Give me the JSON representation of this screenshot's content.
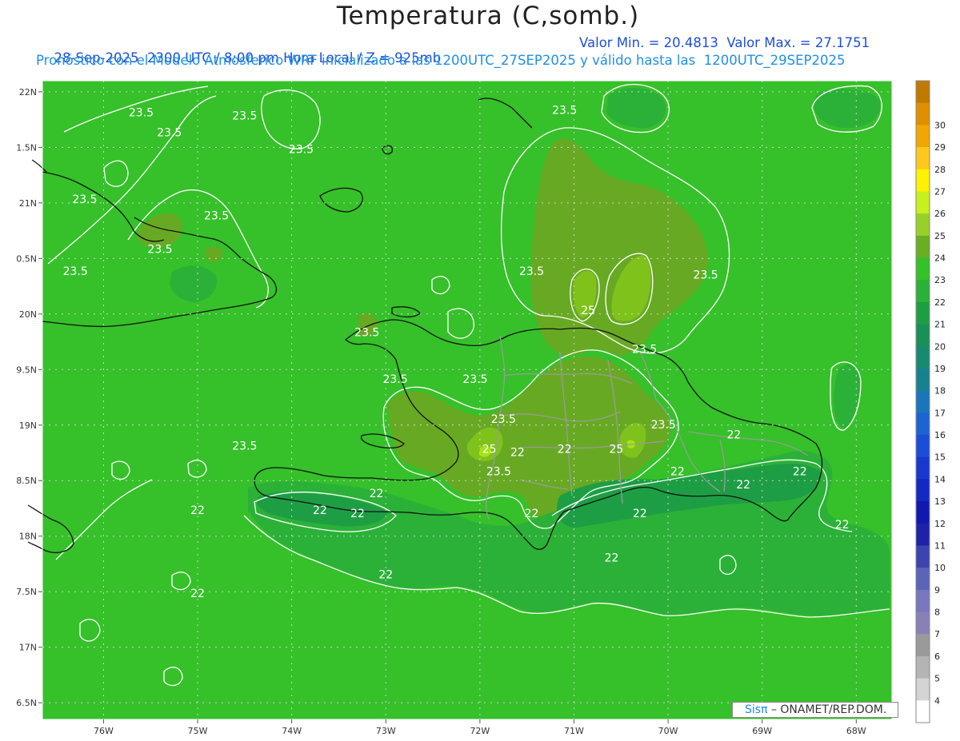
{
  "header": {
    "title": "Temperatura (C,somb.)",
    "line1_left": "28-Sep-2025  2300 UTC / 8:00 pm Hora Local / Z = 925mb",
    "line1_right": "Valor Min. = 20.4813  Valor Max. = 27.1751",
    "line2": "Pronóstico con el Modelo Atmosferico WRF inicializado a las 1200UTC_27SEP2025 y válido hasta las  1200UTC_29SEP2025"
  },
  "map": {
    "lon_range": [
      -76.65,
      -67.62
    ],
    "lat_range": [
      16.35,
      22.1
    ],
    "lat_ticks": [
      {
        "value": 22,
        "label": "22N"
      },
      {
        "value": 21.5,
        "label": "1.5N"
      },
      {
        "value": 21,
        "label": "21N"
      },
      {
        "value": 20.5,
        "label": "0.5N"
      },
      {
        "value": 20,
        "label": "20N"
      },
      {
        "value": 19.5,
        "label": "9.5N"
      },
      {
        "value": 19,
        "label": "19N"
      },
      {
        "value": 18.5,
        "label": "8.5N"
      },
      {
        "value": 18,
        "label": "18N"
      },
      {
        "value": 17.5,
        "label": "7.5N"
      },
      {
        "value": 17,
        "label": "17N"
      },
      {
        "value": 16.5,
        "label": "6.5N"
      }
    ],
    "lon_ticks": [
      {
        "value": -76,
        "label": "76W"
      },
      {
        "value": -75,
        "label": "75W"
      },
      {
        "value": -74,
        "label": "74W"
      },
      {
        "value": -73,
        "label": "73W"
      },
      {
        "value": -72,
        "label": "72W"
      },
      {
        "value": -71,
        "label": "71W"
      },
      {
        "value": -70,
        "label": "70W"
      },
      {
        "value": -69,
        "label": "69W"
      },
      {
        "value": -68,
        "label": "68W"
      }
    ],
    "contour_labels": [
      {
        "text": "23.5",
        "lon": -75.6,
        "lat": 21.78
      },
      {
        "text": "23.5",
        "lon": -74.5,
        "lat": 21.75
      },
      {
        "text": "23.5",
        "lon": -75.3,
        "lat": 21.6
      },
      {
        "text": "23.5",
        "lon": -73.9,
        "lat": 21.45
      },
      {
        "text": "23.5",
        "lon": -76.2,
        "lat": 21.0
      },
      {
        "text": "23.5",
        "lon": -74.8,
        "lat": 20.85
      },
      {
        "text": "23.5",
        "lon": -75.4,
        "lat": 20.55
      },
      {
        "text": "23.5",
        "lon": -76.3,
        "lat": 20.35
      },
      {
        "text": "23.5",
        "lon": -71.1,
        "lat": 21.8
      },
      {
        "text": "23.5",
        "lon": -71.45,
        "lat": 20.35
      },
      {
        "text": "23.5",
        "lon": -69.6,
        "lat": 20.32
      },
      {
        "text": "25",
        "lon": -70.85,
        "lat": 20.0
      },
      {
        "text": "23.5",
        "lon": -73.2,
        "lat": 19.8
      },
      {
        "text": "23.5",
        "lon": -70.25,
        "lat": 19.65
      },
      {
        "text": "23.5",
        "lon": -72.9,
        "lat": 19.38
      },
      {
        "text": "23.5",
        "lon": -72.05,
        "lat": 19.38
      },
      {
        "text": "23.5",
        "lon": -71.75,
        "lat": 19.02
      },
      {
        "text": "23.5",
        "lon": -70.05,
        "lat": 18.97
      },
      {
        "text": "23.5",
        "lon": -74.5,
        "lat": 18.78
      },
      {
        "text": "25",
        "lon": -71.9,
        "lat": 18.75
      },
      {
        "text": "22",
        "lon": -71.6,
        "lat": 18.72
      },
      {
        "text": "22",
        "lon": -71.1,
        "lat": 18.75
      },
      {
        "text": "25",
        "lon": -70.55,
        "lat": 18.75
      },
      {
        "text": "22",
        "lon": -69.3,
        "lat": 18.88
      },
      {
        "text": "23.5",
        "lon": -71.8,
        "lat": 18.55
      },
      {
        "text": "22",
        "lon": -69.9,
        "lat": 18.55
      },
      {
        "text": "22",
        "lon": -69.2,
        "lat": 18.43
      },
      {
        "text": "22",
        "lon": -68.6,
        "lat": 18.55
      },
      {
        "text": "22",
        "lon": -73.1,
        "lat": 18.35
      },
      {
        "text": "22",
        "lon": -75.0,
        "lat": 18.2
      },
      {
        "text": "22",
        "lon": -73.7,
        "lat": 18.2
      },
      {
        "text": "22",
        "lon": -73.3,
        "lat": 18.17
      },
      {
        "text": "22",
        "lon": -71.45,
        "lat": 18.17
      },
      {
        "text": "22",
        "lon": -70.3,
        "lat": 18.17
      },
      {
        "text": "22",
        "lon": -68.15,
        "lat": 18.07
      },
      {
        "text": "22",
        "lon": -70.6,
        "lat": 17.77
      },
      {
        "text": "22",
        "lon": -73.0,
        "lat": 17.62
      },
      {
        "text": "22",
        "lon": -75.0,
        "lat": 17.45
      }
    ],
    "colors": {
      "c21": "#1e9e44",
      "c22": "#2bb138",
      "c23": "#36c02a",
      "c24": "#68a924",
      "c25": "#7fc21b",
      "c26": "#a6e214"
    }
  },
  "colorbar": {
    "levels": [
      {
        "label": "",
        "color": "#c07a00"
      },
      {
        "label": "30",
        "color": "#e08f00"
      },
      {
        "label": "29",
        "color": "#f0a800"
      },
      {
        "label": "28",
        "color": "#ffc81a"
      },
      {
        "label": "27",
        "color": "#fff200"
      },
      {
        "label": "26",
        "color": "#c8f01c"
      },
      {
        "label": "25",
        "color": "#98d02a"
      },
      {
        "label": "24",
        "color": "#6aae24"
      },
      {
        "label": "23",
        "color": "#36c02a"
      },
      {
        "label": "22",
        "color": "#2bb138"
      },
      {
        "label": "21",
        "color": "#1e9e44"
      },
      {
        "label": "20",
        "color": "#1a9058"
      },
      {
        "label": "19",
        "color": "#198a72"
      },
      {
        "label": "18",
        "color": "#17828e"
      },
      {
        "label": "17",
        "color": "#1a76b8"
      },
      {
        "label": "16",
        "color": "#1c64d2"
      },
      {
        "label": "15",
        "color": "#1a4ed8"
      },
      {
        "label": "14",
        "color": "#1838d0"
      },
      {
        "label": "13",
        "color": "#1428c4"
      },
      {
        "label": "12",
        "color": "#1018b0"
      },
      {
        "label": "11",
        "color": "#1e22a8"
      },
      {
        "label": "10",
        "color": "#3c44b0"
      },
      {
        "label": "9",
        "color": "#5a64b8"
      },
      {
        "label": "8",
        "color": "#7878c0"
      },
      {
        "label": "7",
        "color": "#8a80b8"
      },
      {
        "label": "6",
        "color": "#9a9a9a"
      },
      {
        "label": "5",
        "color": "#b4b4b4"
      },
      {
        "label": "4",
        "color": "#d4d4d4"
      },
      {
        "label": "",
        "color": "#ffffff"
      }
    ]
  },
  "credit": {
    "sis": "Sisπ",
    "rest": " – ONAMET/REP.DOM."
  }
}
